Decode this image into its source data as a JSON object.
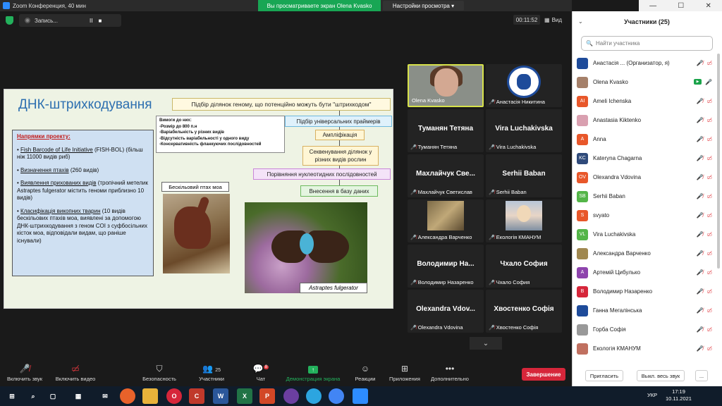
{
  "window": {
    "title": "Zoom Конференция, 40 мин",
    "controls": [
      "—",
      "☐",
      "✕"
    ]
  },
  "share_banner": {
    "text": "Вы просматриваете экран Olena Kvasko",
    "view_settings": "Настройки просмотра"
  },
  "recording": {
    "label": "Запись...",
    "pause": "II",
    "stop": "■"
  },
  "timer": "00:11:52",
  "view_label": "Вид",
  "slide": {
    "title": "ДНК-штрихкодування",
    "flow": [
      "Підбір ділянок геному, що потенційно можуть бути \"штрихкодом\"",
      "Підбір універсальних праймерів",
      "Ампліфікація",
      "Секвенування ділянок у різних видів рослин",
      "Порівняння нуклеотидних послідовностей",
      "Внесення в базу даних"
    ],
    "requirements": {
      "title": "Вимоги до них:",
      "items": [
        "-Розмір до 800 п.н",
        "-Варіабельність у різних видів",
        "-Відсутність варіабельності у одного виду",
        "-Консервативність фланкуючих послідовностей"
      ]
    },
    "directions": {
      "header": "Напрямки проекту:",
      "items": [
        {
          "title": "Fish Barcode of Life Initiative",
          "rest": " (FISH-BOL) (більш ніж 11000 видів риб)"
        },
        {
          "title": "Визначення птахів",
          "rest": " (260 видів)"
        },
        {
          "title": "Виявлення прихованих видів",
          "rest": " (тропічний метелик Astraptes fulgerator містить геноми приблизно 10 видів)"
        },
        {
          "title": "Класифікація викопних тварин",
          "rest": " (10 видів бескільових птахів моа, виявлені за допомогою ДНК-штрихкодування з геном COI з суфбосільних кісток моа, відповідали видам, що раніше існували)"
        }
      ]
    },
    "moa_label": "Бескільовий птах моа",
    "butterfly_label": "Astraptes fulgerator"
  },
  "tiles": [
    {
      "id": "olena",
      "small": "Olena Kvasko",
      "big": ""
    },
    {
      "id": "anast",
      "small": "Анастасія Никитина",
      "big": ""
    },
    {
      "id": "tum",
      "small": "Туманян Тетяна",
      "big": "Туманян Тетяна"
    },
    {
      "id": "vira",
      "small": "Vira Luchakivska",
      "big": "Vira Luchakivska"
    },
    {
      "id": "makh",
      "small": "Махлайчук Светислав",
      "big": "Махлайчук Све..."
    },
    {
      "id": "serhii",
      "small": "Serhii Baban",
      "big": "Serhii Baban"
    },
    {
      "id": "alex",
      "small": "Александра Варченко",
      "big": ""
    },
    {
      "id": "ekol",
      "small": "Екологія КМАНУМ",
      "big": ""
    },
    {
      "id": "volod",
      "small": "Володимир Назаренко",
      "big": "Володимир На..."
    },
    {
      "id": "chkh",
      "small": "Чхало София",
      "big": "Чхало София"
    },
    {
      "id": "olex",
      "small": "Olexandra Vdovina",
      "big": "Olexandra Vdov..."
    },
    {
      "id": "khv",
      "small": "Хвостенко Софія",
      "big": "Хвостенко Софія"
    }
  ],
  "panel": {
    "title": "Участники (25)",
    "search_placeholder": "Найти участника",
    "participants": [
      {
        "name": "Анастасія ... (Организатор, я)",
        "initials": "",
        "color": "#1e4b9a"
      },
      {
        "name": "Olena Kvasko",
        "initials": "",
        "color": "#a5806a"
      },
      {
        "name": "Ameli  Ichenska",
        "initials": "AI",
        "color": "#e8572a"
      },
      {
        "name": "Anastasia Kiktenko",
        "initials": "",
        "color": "#d9a0b0"
      },
      {
        "name": "Anna",
        "initials": "A",
        "color": "#e8572a"
      },
      {
        "name": "Kateryna Chagarna",
        "initials": "KC",
        "color": "#2f4a7a"
      },
      {
        "name": "Olexandra Vdovina",
        "initials": "OV",
        "color": "#e8572a"
      },
      {
        "name": "Serhii Baban",
        "initials": "SB",
        "color": "#54b548"
      },
      {
        "name": "svyato",
        "initials": "S",
        "color": "#e8572a"
      },
      {
        "name": "Vira Luchakivska",
        "initials": "VL",
        "color": "#54b548"
      },
      {
        "name": "Александра Варченко",
        "initials": "",
        "color": "#a08850"
      },
      {
        "name": "Артемій Цибулько",
        "initials": "A",
        "color": "#8e44ad"
      },
      {
        "name": "Володимир Назаренко",
        "initials": "B",
        "color": "#d6263a"
      },
      {
        "name": "Ганна Мегалінська",
        "initials": "",
        "color": "#1e4b9a"
      },
      {
        "name": "Горба Софія",
        "initials": "",
        "color": "#999999"
      },
      {
        "name": "Екологія КМАНУМ",
        "initials": "",
        "color": "#c07060"
      }
    ],
    "invite": "Пригласить",
    "mute_all": "Выкл. весь звук",
    "more": "..."
  },
  "toolbar": {
    "audio": "Включить звук",
    "video": "Включить видео",
    "security": "Безопасность",
    "participants": "Участники",
    "participants_count": "25",
    "chat": "Чат",
    "chat_badge": "8",
    "share": "Демонстрация экрана",
    "reactions": "Реакции",
    "apps": "Приложения",
    "more": "Дополнительно",
    "end": "Завершение"
  },
  "taskbar": {
    "lang": "УКР",
    "time": "17:19",
    "date": "10.11.2021"
  }
}
